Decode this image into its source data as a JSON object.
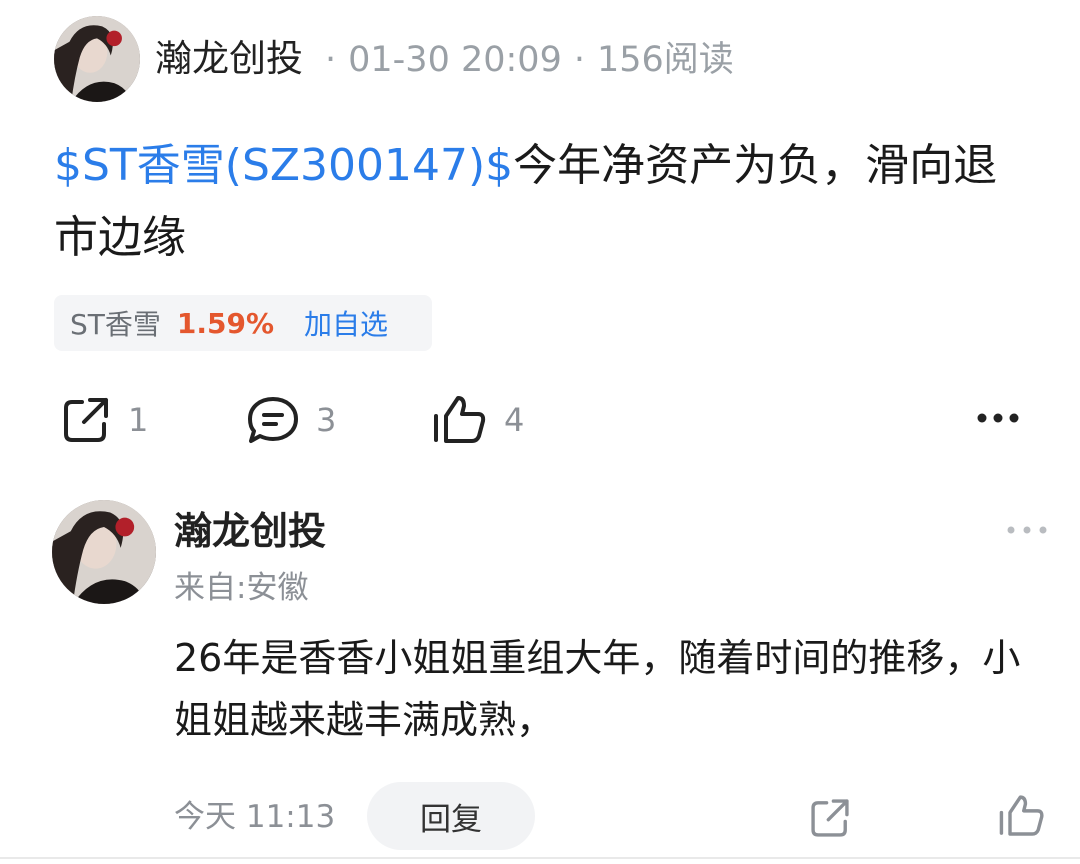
{
  "post": {
    "author": "瀚龙创投",
    "date": "01-30 20:09",
    "reads": "156阅读",
    "meta_sep": "·",
    "stock_link": "$ST香雪(SZ300147)$",
    "title_rest": "今年净资产为负，滑向退市边缘"
  },
  "stock_chip": {
    "name": "ST香雪",
    "change": "1.59%",
    "watch_label": "加自选"
  },
  "actions": {
    "share_count": "1",
    "comment_count": "3",
    "like_count": "4",
    "more_icon": "ellipsis-icon"
  },
  "comment": {
    "author": "瀚龙创投",
    "location": "来自:安徽",
    "body": "26年是香香小姐姐重组大年，随着时间的推移，小姐姐越来越丰满成熟，",
    "time": "今天 11:13",
    "reply_label": "回复"
  },
  "colors": {
    "link": "#2b7de9",
    "up": "#e4572e",
    "muted": "#8c9096"
  }
}
